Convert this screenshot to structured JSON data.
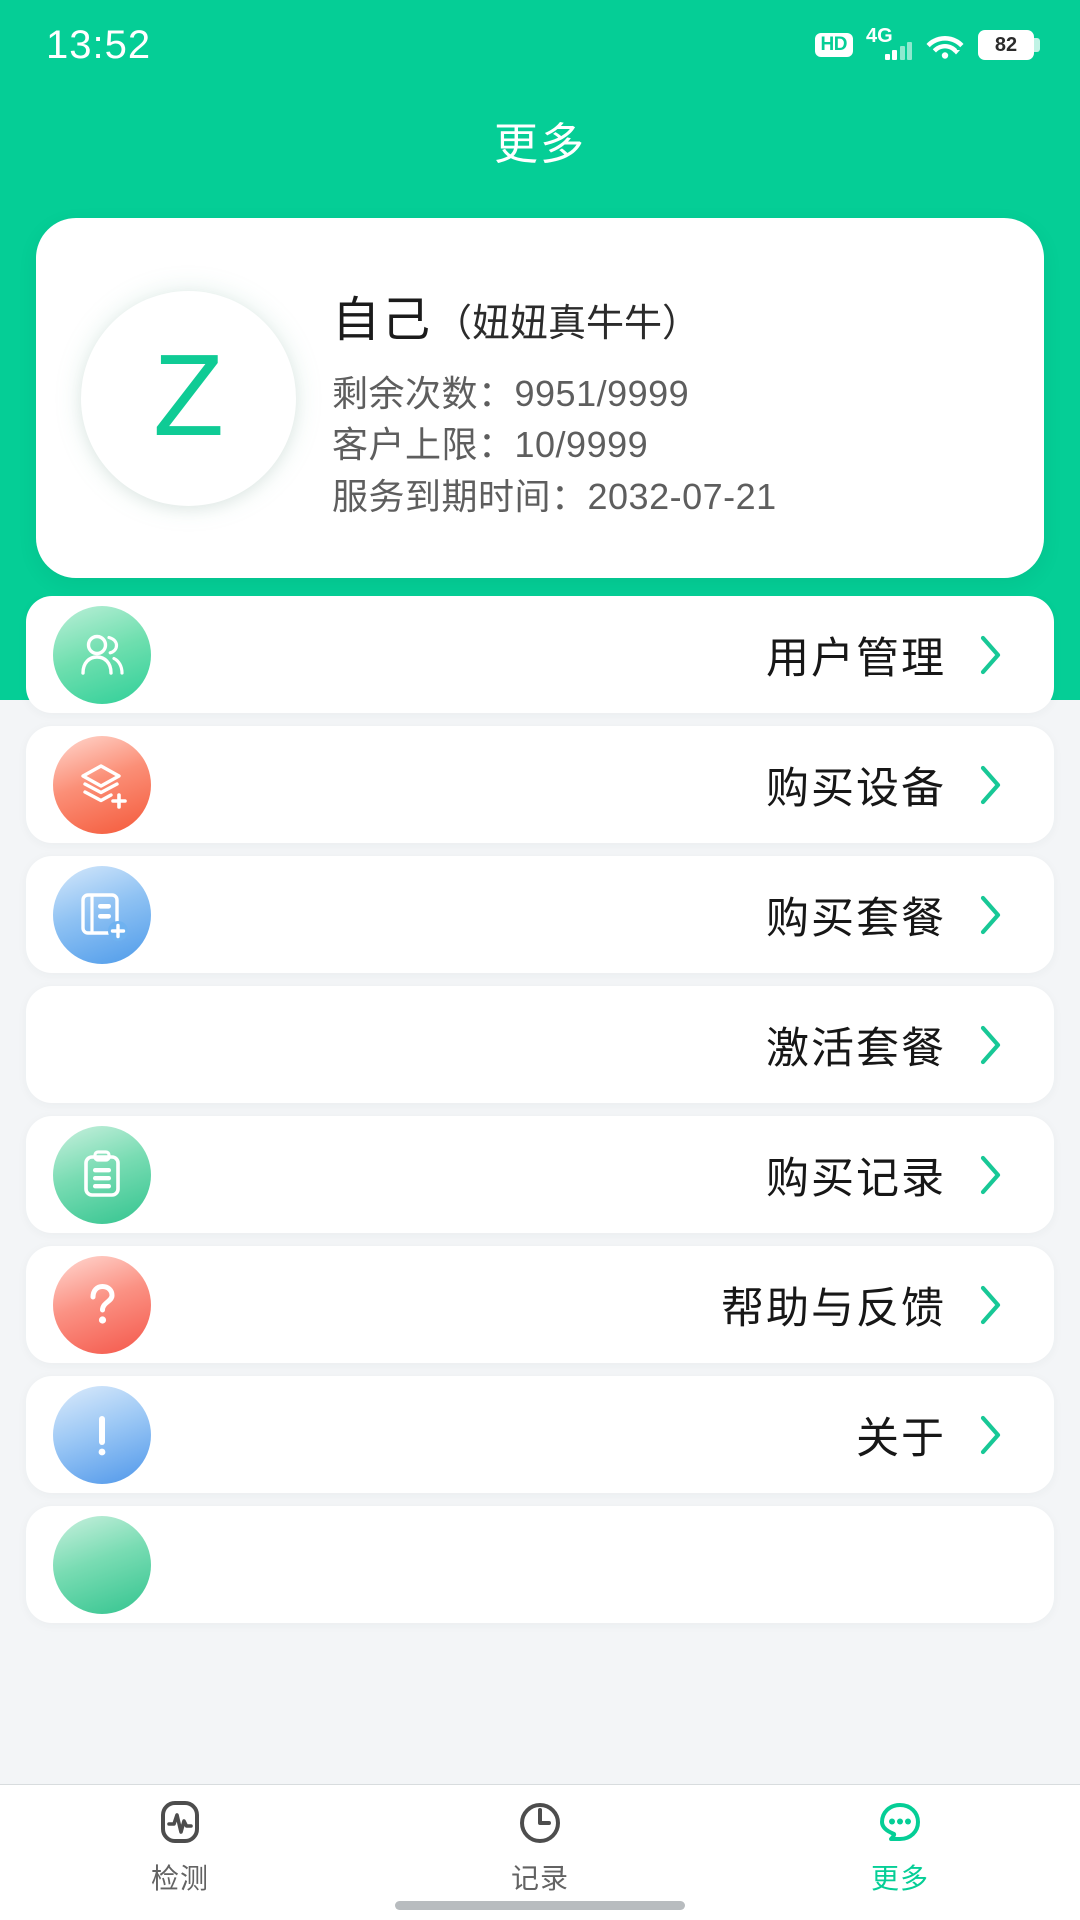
{
  "theme": {
    "brand_green": "#05CE96",
    "page_bg": "#F3F5F7",
    "card_bg": "#FFFFFF",
    "chevron_green": "#18C896"
  },
  "status_bar": {
    "time": "13:52",
    "hd_label": "HD",
    "network_label": "4G",
    "battery_level": "82",
    "wifi_icon": "wifi-icon",
    "signal_icon": "signal-bars-icon"
  },
  "header": {
    "title": "更多"
  },
  "profile": {
    "avatar_letter": "Z",
    "name": "自己",
    "alias": "（妞妞真牛牛）",
    "stats": [
      "剩余次数：9951/9999",
      "客户上限：10/9999",
      "服务到期时间：2032-07-21"
    ],
    "remaining_count": "9951/9999",
    "customer_limit": "10/9999",
    "service_expiry": "2032-07-21"
  },
  "menu": {
    "items": [
      {
        "label": "用户管理",
        "icon": "users-icon",
        "icon_class": "ic-users"
      },
      {
        "label": "购买设备",
        "icon": "layers-plus-icon",
        "icon_class": "ic-device"
      },
      {
        "label": "购买套餐",
        "icon": "document-plus-icon",
        "icon_class": "ic-package"
      },
      {
        "label": "激活套餐",
        "icon": "qr-code-icon",
        "icon_class": "ic-activate"
      },
      {
        "label": "购买记录",
        "icon": "clipboard-list-icon",
        "icon_class": "ic-record"
      },
      {
        "label": "帮助与反馈",
        "icon": "question-mark-icon",
        "icon_class": "ic-help"
      },
      {
        "label": "关于",
        "icon": "exclamation-mark-icon",
        "icon_class": "ic-about"
      }
    ],
    "chevron_icon": "chevron-right-icon"
  },
  "bottom_nav": {
    "items": [
      {
        "label": "检测",
        "icon": "pulse-waveform-icon",
        "active": false
      },
      {
        "label": "记录",
        "icon": "clock-icon",
        "active": false
      },
      {
        "label": "更多",
        "icon": "more-chat-dots-icon",
        "active": true
      }
    ]
  }
}
